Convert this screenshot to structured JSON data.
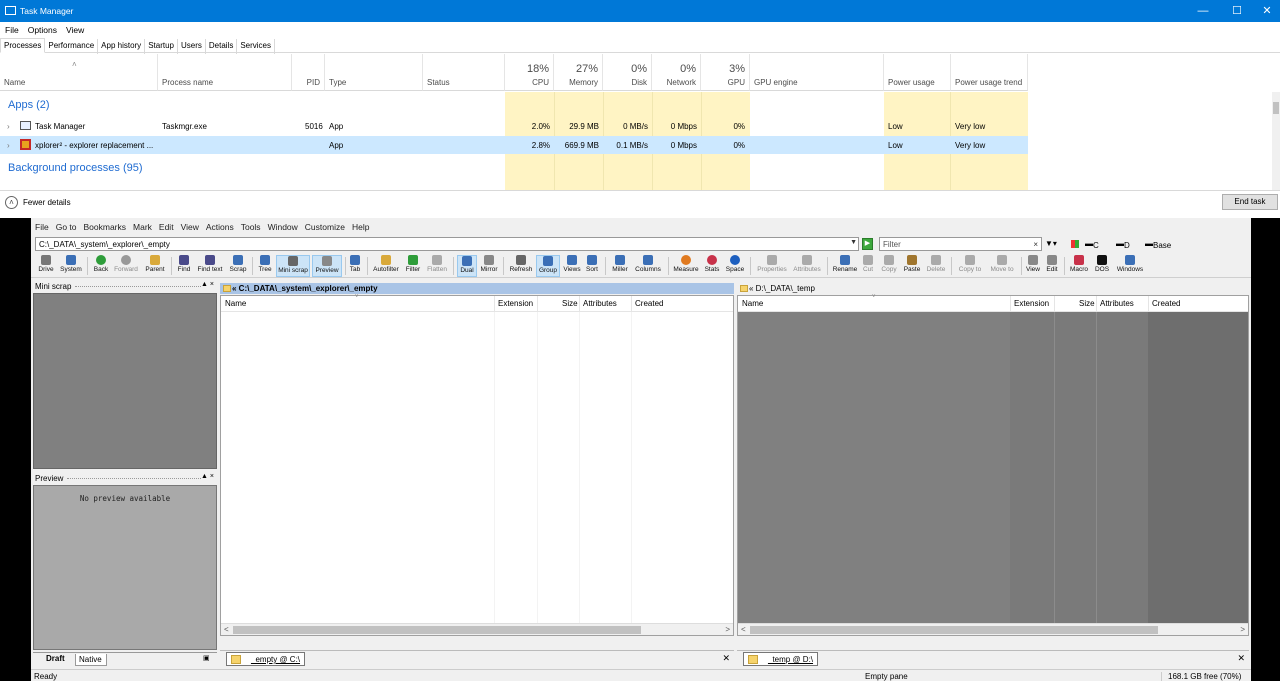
{
  "task_manager": {
    "title": "Task Manager",
    "menu": [
      "File",
      "Options",
      "View"
    ],
    "tabs": [
      "Processes",
      "Performance",
      "App history",
      "Startup",
      "Users",
      "Details",
      "Services"
    ],
    "columns": {
      "name": "Name",
      "process_name": "Process name",
      "pid": "PID",
      "type": "Type",
      "status": "Status",
      "cpu": {
        "pct": "18%",
        "label": "CPU"
      },
      "memory": {
        "pct": "27%",
        "label": "Memory"
      },
      "disk": {
        "pct": "0%",
        "label": "Disk"
      },
      "network": {
        "pct": "0%",
        "label": "Network"
      },
      "gpu": {
        "pct": "3%",
        "label": "GPU"
      },
      "gpu_engine": "GPU engine",
      "power_usage": "Power usage",
      "power_trend": "Power usage trend"
    },
    "groups": {
      "apps": "Apps (2)",
      "background": "Background processes (95)"
    },
    "rows": [
      {
        "name": "Task Manager",
        "process": "Taskmgr.exe",
        "pid": "5016",
        "type": "App",
        "cpu": "2.0%",
        "memory": "29.9 MB",
        "disk": "0 MB/s",
        "network": "0 Mbps",
        "gpu": "0%",
        "power": "Low",
        "trend": "Very low"
      },
      {
        "name": "xplorer² - explorer replacement ...",
        "process": "",
        "pid": "",
        "type": "App",
        "cpu": "2.8%",
        "memory": "669.9 MB",
        "disk": "0.1 MB/s",
        "network": "0 Mbps",
        "gpu": "0%",
        "power": "Low",
        "trend": "Very low"
      }
    ],
    "fewer_details": "Fewer details",
    "end_task": "End task"
  },
  "xplorer": {
    "menu": [
      "File",
      "Go to",
      "Bookmarks",
      "Mark",
      "Edit",
      "View",
      "Actions",
      "Tools",
      "Window",
      "Customize",
      "Help"
    ],
    "address": "C:\\_DATA\\_system\\_explorer\\_empty",
    "filter_placeholder": "Filter",
    "drive_c": "C",
    "drive_d": "D",
    "base": "Base",
    "toolbar": [
      "Drive",
      "System",
      "Back",
      "Forward",
      "Parent",
      "Find",
      "Find text",
      "Scrap",
      "Tree",
      "Mini scrap",
      "Preview",
      "Tab",
      "Autofilter",
      "Filter",
      "Flatten",
      "Dual",
      "Mirror",
      "Refresh",
      "Group",
      "Views",
      "Sort",
      "Miller",
      "Columns",
      "Measure",
      "Stats",
      "Space",
      "Properties",
      "Attributes",
      "Rename",
      "Cut",
      "Copy",
      "Paste",
      "Delete",
      "Copy to",
      "Move to",
      "View",
      "Edit",
      "Macro",
      "DOS",
      "Windows"
    ],
    "mini_scrap_title": "Mini scrap",
    "preview_title": "Preview",
    "no_preview": "No preview available",
    "scrap_tabs": [
      "Draft",
      "Native"
    ],
    "pane1": {
      "title": "« C:\\_DATA\\_system\\_explorer\\_empty",
      "tab": "_empty @ C:\\"
    },
    "pane2": {
      "title": "« D:\\_DATA\\_temp",
      "tab": "_temp @ D:\\"
    },
    "list_columns": [
      "Name",
      "Extension",
      "Size",
      "Attributes",
      "Created"
    ],
    "status": {
      "left": "Ready",
      "middle": "Empty pane",
      "right": "168.1 GB free (70%)"
    },
    "colors": {
      "titlebar": "#0078d7",
      "active_pane": "#a9c4e6",
      "heat": "#fff4c4",
      "selection": "#cce8ff"
    }
  }
}
